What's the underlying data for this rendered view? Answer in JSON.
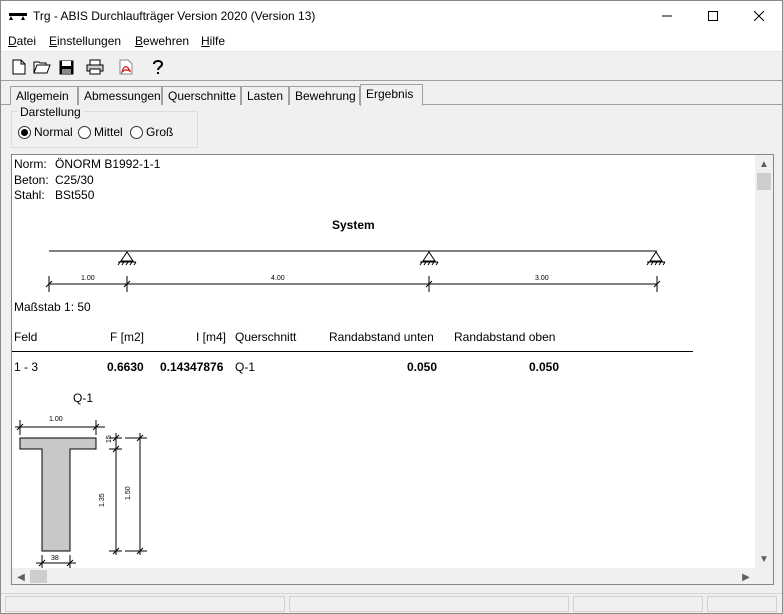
{
  "window": {
    "title": "Trg - ABIS Durchlaufträger Version 2020 (Version 13)"
  },
  "menu": {
    "datei_first": "D",
    "datei_rest": "atei",
    "einstellungen_first": "E",
    "einstellungen_rest": "instellungen",
    "bewehren_first": "B",
    "bewehren_rest": "ewehren",
    "hilfe_first": "H",
    "hilfe_rest": "ilfe"
  },
  "toolbar": {
    "icons": [
      "new-file-icon",
      "open-folder-icon",
      "save-icon",
      "print-icon",
      "pdf-icon",
      "help-icon"
    ]
  },
  "tabs": [
    {
      "label": "Allgemein"
    },
    {
      "label": "Abmessungen"
    },
    {
      "label": "Querschnitte"
    },
    {
      "label": "Lasten"
    },
    {
      "label": "Bewehrung"
    },
    {
      "label": "Ergebnis",
      "active": true
    }
  ],
  "darstellung": {
    "legend": "Darstellung",
    "options": [
      "Normal",
      "Mittel",
      "Groß"
    ],
    "selected": "Normal"
  },
  "report": {
    "norm_label": "Norm:",
    "norm_value": "ÖNORM B1992-1-1",
    "beton_label": "Beton:",
    "beton_value": "C25/30",
    "stahl_label": "Stahl:",
    "stahl_value": "BSt550",
    "system_title": "System",
    "dims": [
      "1.00",
      "4.00",
      "3.00"
    ],
    "scale": "Maßstab 1: 50",
    "table": {
      "headers": [
        "Feld",
        "F [m2]",
        "I [m4]",
        "Querschnitt",
        "Randabstand unten",
        "Randabstand oben"
      ],
      "row": [
        "1 - 3",
        "0.6630",
        "0.14347876",
        "Q-1",
        "0.050",
        "0.050"
      ]
    },
    "section": {
      "name": "Q-1",
      "width_top": "1.00",
      "flange": "15",
      "web_height": "1.35",
      "total_height": "1.50",
      "web_width": "38"
    }
  },
  "colors": {
    "section_fill": "#c8c8c8",
    "pdf_red": "#cc2020"
  }
}
